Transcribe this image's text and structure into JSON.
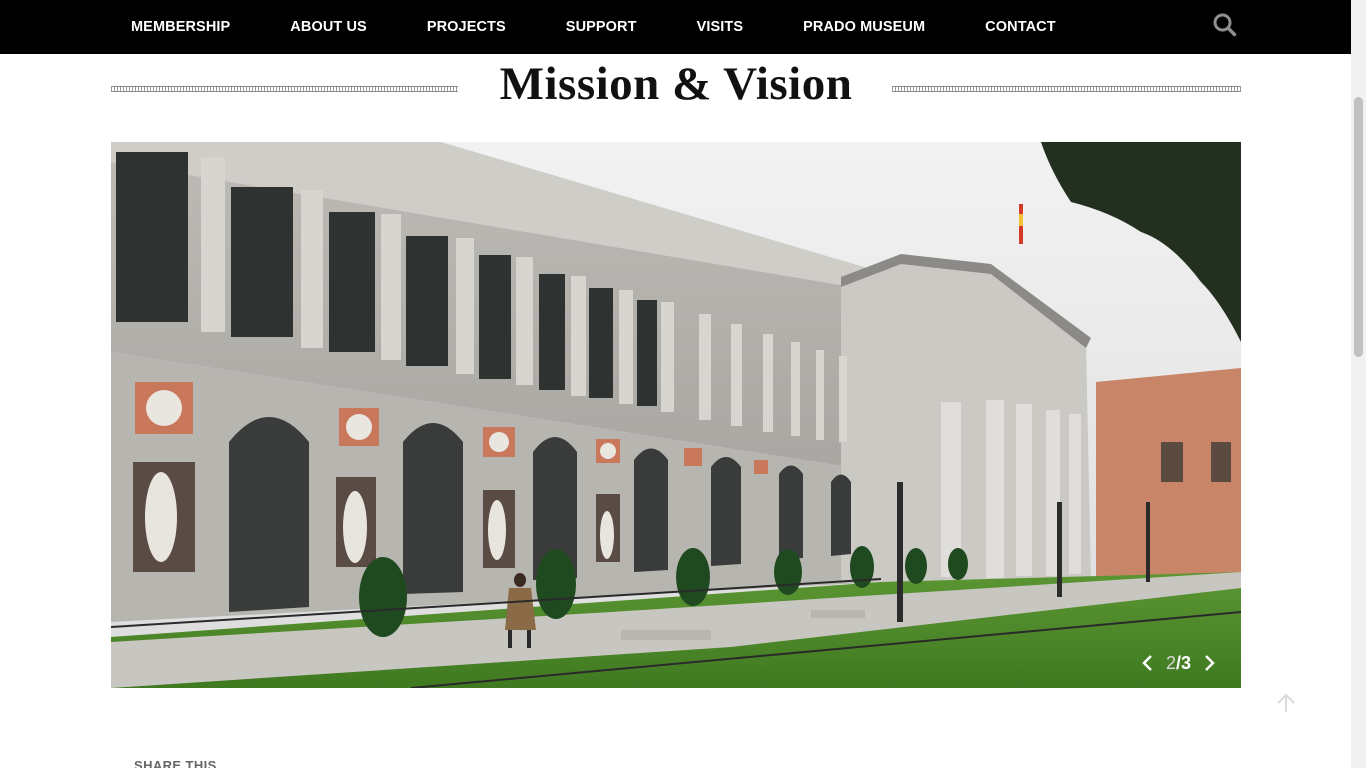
{
  "nav": {
    "items": [
      {
        "label": "MEMBERSHIP"
      },
      {
        "label": "ABOUT US"
      },
      {
        "label": "PROJECTS"
      },
      {
        "label": "SUPPORT"
      },
      {
        "label": "VISITS"
      },
      {
        "label": "PRADO MUSEUM"
      },
      {
        "label": "CONTACT"
      }
    ],
    "search_icon": "search-icon"
  },
  "page": {
    "title": "Mission & Vision"
  },
  "slider": {
    "image_subject": "Prado Museum facade with columns, statues and lawn",
    "current": "2",
    "separator": "/",
    "total": "3",
    "prev_icon": "chevron-left-icon",
    "next_icon": "chevron-right-icon"
  },
  "footer": {
    "share_label": "SHARE THIS",
    "to_top_icon": "arrow-up-icon"
  },
  "colors": {
    "topbar": "#000000",
    "nav_text": "#ffffff",
    "title_text": "#111111",
    "stone": "#c9c7c2",
    "terracotta": "#c9785c",
    "lawn": "#4f8a2c"
  }
}
